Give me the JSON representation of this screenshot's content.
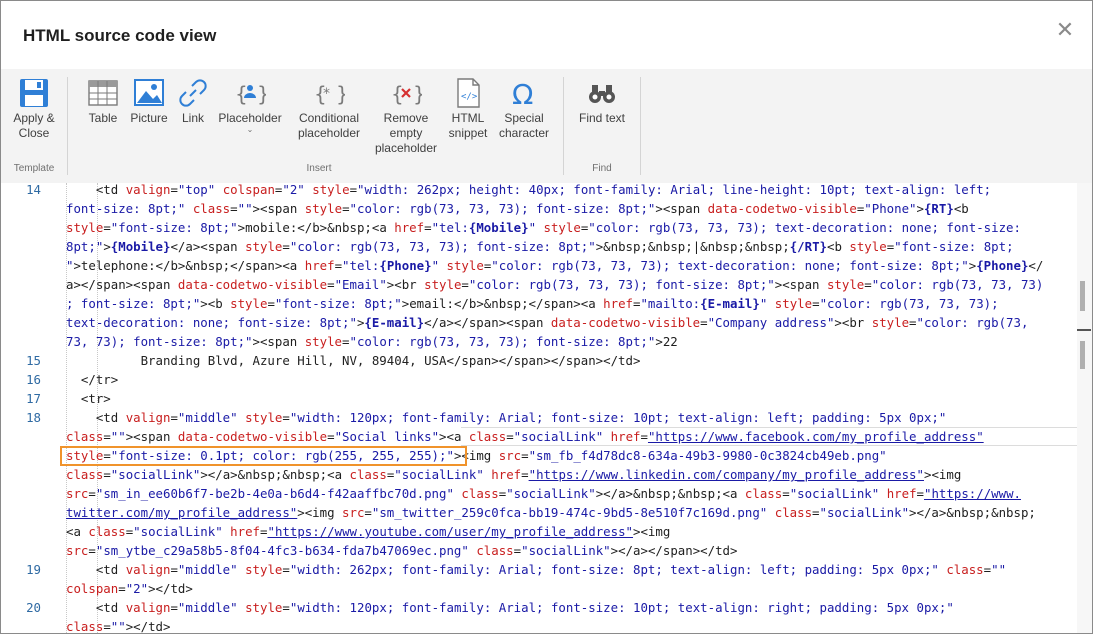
{
  "dialog": {
    "title": "HTML source code view",
    "close_glyph": "✕"
  },
  "ribbon": {
    "groups": [
      {
        "label": "Template"
      },
      {
        "label": "Insert"
      },
      {
        "label": "Find"
      }
    ],
    "buttons": {
      "apply_close": [
        "Apply &",
        "Close"
      ],
      "table": "Table",
      "picture": "Picture",
      "link": "Link",
      "placeholder": "Placeholder",
      "conditional": [
        "Conditional",
        "placeholder"
      ],
      "remove_empty": [
        "Remove",
        "empty",
        "placeholder"
      ],
      "html_snippet": [
        "HTML",
        "snippet"
      ],
      "special_char": [
        "Special",
        "character"
      ],
      "find_text": "Find text"
    },
    "accent": "#2f7fd6"
  },
  "code": {
    "line_numbers": [
      "14",
      "15",
      "16",
      "17",
      "18",
      "19",
      "20"
    ],
    "lines": [
      {
        "n": "14",
        "segs": [
          [
            "t",
            "    "
          ],
          [
            "g",
            "<td "
          ],
          [
            "a",
            "valign"
          ],
          [
            "g",
            "="
          ],
          [
            "v",
            "\"top\""
          ],
          [
            "g",
            " "
          ],
          [
            "a",
            "colspan"
          ],
          [
            "g",
            "="
          ],
          [
            "v",
            "\"2\""
          ],
          [
            "g",
            " "
          ],
          [
            "a",
            "style"
          ],
          [
            "g",
            "="
          ],
          [
            "v",
            "\"width: 262px; height: 40px; font-family: Arial; line-height: 10pt; text-align: left;"
          ]
        ]
      },
      {
        "n": "",
        "segs": [
          [
            "v",
            "font-size: 8pt;\""
          ],
          [
            "g",
            " "
          ],
          [
            "a",
            "class"
          ],
          [
            "g",
            "="
          ],
          [
            "v",
            "\"\""
          ],
          [
            "g",
            "><span "
          ],
          [
            "a",
            "style"
          ],
          [
            "g",
            "="
          ],
          [
            "v",
            "\"color: rgb(73, 73, 73); font-size: 8pt;\""
          ],
          [
            "g",
            "><span "
          ],
          [
            "a",
            "data-codetwo-visible"
          ],
          [
            "g",
            "="
          ],
          [
            "v",
            "\"Phone\""
          ],
          [
            "g",
            ">"
          ],
          [
            "b",
            "{RT}"
          ],
          [
            "g",
            "<b"
          ]
        ]
      },
      {
        "n": "",
        "segs": [
          [
            "a",
            "style"
          ],
          [
            "g",
            "="
          ],
          [
            "v",
            "\"font-size: 8pt;\""
          ],
          [
            "g",
            ">mobile:</b>&nbsp;<a "
          ],
          [
            "a",
            "href"
          ],
          [
            "g",
            "="
          ],
          [
            "v",
            "\"tel:"
          ],
          [
            "b",
            "{Mobile}"
          ],
          [
            "v",
            "\""
          ],
          [
            "g",
            " "
          ],
          [
            "a",
            "style"
          ],
          [
            "g",
            "="
          ],
          [
            "v",
            "\"color: rgb(73, 73, 73); text-decoration: none; font-size:"
          ]
        ]
      },
      {
        "n": "",
        "segs": [
          [
            "v",
            "8pt;\""
          ],
          [
            "g",
            ">"
          ],
          [
            "b",
            "{Mobile}"
          ],
          [
            "g",
            "</a><span "
          ],
          [
            "a",
            "style"
          ],
          [
            "g",
            "="
          ],
          [
            "v",
            "\"color: rgb(73, 73, 73); font-size: 8pt;\""
          ],
          [
            "g",
            ">&nbsp;&nbsp;|&nbsp;&nbsp;"
          ],
          [
            "b",
            "{/RT}"
          ],
          [
            "g",
            "<b "
          ],
          [
            "a",
            "style"
          ],
          [
            "g",
            "="
          ],
          [
            "v",
            "\"font-size: 8pt;"
          ]
        ]
      },
      {
        "n": "",
        "segs": [
          [
            "v",
            "\""
          ],
          [
            "g",
            ">telephone:</b>&nbsp;</span><a "
          ],
          [
            "a",
            "href"
          ],
          [
            "g",
            "="
          ],
          [
            "v",
            "\"tel:"
          ],
          [
            "b",
            "{Phone}"
          ],
          [
            "v",
            "\""
          ],
          [
            "g",
            " "
          ],
          [
            "a",
            "style"
          ],
          [
            "g",
            "="
          ],
          [
            "v",
            "\"color: rgb(73, 73, 73); text-decoration: none; font-size: 8pt;\""
          ],
          [
            "g",
            ">"
          ],
          [
            "b",
            "{Phone}"
          ],
          [
            "g",
            "</"
          ]
        ]
      },
      {
        "n": "",
        "segs": [
          [
            "g",
            "a></span><span "
          ],
          [
            "a",
            "data-codetwo-visible"
          ],
          [
            "g",
            "="
          ],
          [
            "v",
            "\"Email\""
          ],
          [
            "g",
            "><br "
          ],
          [
            "a",
            "style"
          ],
          [
            "g",
            "="
          ],
          [
            "v",
            "\"color: rgb(73, 73, 73); font-size: 8pt;\""
          ],
          [
            "g",
            "><span "
          ],
          [
            "a",
            "style"
          ],
          [
            "g",
            "="
          ],
          [
            "v",
            "\"color: rgb(73, 73, 73)"
          ]
        ]
      },
      {
        "n": "",
        "segs": [
          [
            "v",
            "; font-size: 8pt;\""
          ],
          [
            "g",
            "><b "
          ],
          [
            "a",
            "style"
          ],
          [
            "g",
            "="
          ],
          [
            "v",
            "\"font-size: 8pt;\""
          ],
          [
            "g",
            ">email:</b>&nbsp;</span><a "
          ],
          [
            "a",
            "href"
          ],
          [
            "g",
            "="
          ],
          [
            "v",
            "\"mailto:"
          ],
          [
            "b",
            "{E-mail}"
          ],
          [
            "v",
            "\""
          ],
          [
            "g",
            " "
          ],
          [
            "a",
            "style"
          ],
          [
            "g",
            "="
          ],
          [
            "v",
            "\"color: rgb(73, 73, 73);"
          ]
        ]
      },
      {
        "n": "",
        "segs": [
          [
            "v",
            "text-decoration: none; font-size: 8pt;\""
          ],
          [
            "g",
            ">"
          ],
          [
            "b",
            "{E-mail}"
          ],
          [
            "g",
            "</a></span><span "
          ],
          [
            "a",
            "data-codetwo-visible"
          ],
          [
            "g",
            "="
          ],
          [
            "v",
            "\"Company address\""
          ],
          [
            "g",
            "><br "
          ],
          [
            "a",
            "style"
          ],
          [
            "g",
            "="
          ],
          [
            "v",
            "\"color: rgb(73,"
          ]
        ]
      },
      {
        "n": "",
        "segs": [
          [
            "v",
            "73, 73); font-size: 8pt;\""
          ],
          [
            "g",
            "><span "
          ],
          [
            "a",
            "style"
          ],
          [
            "g",
            "="
          ],
          [
            "v",
            "\"color: rgb(73, 73, 73); font-size: 8pt;\""
          ],
          [
            "g",
            ">22"
          ]
        ]
      },
      {
        "n": "15",
        "segs": [
          [
            "t",
            "          Branding Blvd, Azure Hill, NV, 89404, USA"
          ],
          [
            "g",
            "</span></span></span></td>"
          ]
        ]
      },
      {
        "n": "16",
        "segs": [
          [
            "t",
            "  "
          ],
          [
            "g",
            "</tr>"
          ]
        ]
      },
      {
        "n": "17",
        "segs": [
          [
            "t",
            "  "
          ],
          [
            "g",
            "<tr>"
          ]
        ]
      },
      {
        "n": "18",
        "segs": [
          [
            "t",
            "    "
          ],
          [
            "g",
            "<td "
          ],
          [
            "a",
            "valign"
          ],
          [
            "g",
            "="
          ],
          [
            "v",
            "\"middle\""
          ],
          [
            "g",
            " "
          ],
          [
            "a",
            "style"
          ],
          [
            "g",
            "="
          ],
          [
            "v",
            "\"width: 120px; font-family: Arial; font-size: 10pt; text-align: left; padding: 5px 0px;\""
          ]
        ]
      },
      {
        "n": "",
        "segs": [
          [
            "a",
            "class"
          ],
          [
            "g",
            "="
          ],
          [
            "v",
            "\"\""
          ],
          [
            "g",
            "><span "
          ],
          [
            "a",
            "data-codetwo-visible"
          ],
          [
            "g",
            "="
          ],
          [
            "v",
            "\"Social links\""
          ],
          [
            "g",
            "><a "
          ],
          [
            "a",
            "class"
          ],
          [
            "g",
            "="
          ],
          [
            "v",
            "\"socialLink\""
          ],
          [
            "g",
            " "
          ],
          [
            "a",
            "href"
          ],
          [
            "g",
            "="
          ],
          [
            "u",
            "\"https://www.facebook.com/my_profile_address\""
          ]
        ]
      },
      {
        "n": "",
        "segs": [
          [
            "a",
            "style"
          ],
          [
            "g",
            "="
          ],
          [
            "v",
            "\"font-size: 0.1pt; color: rgb(255, 255, 255);\""
          ],
          [
            "g",
            "><img "
          ],
          [
            "a",
            "src"
          ],
          [
            "g",
            "="
          ],
          [
            "v",
            "\"sm_fb_f4d78dc8-634a-49b3-9980-0c3824cb49eb.png\""
          ]
        ]
      },
      {
        "n": "",
        "segs": [
          [
            "a",
            "class"
          ],
          [
            "g",
            "="
          ],
          [
            "v",
            "\"socialLink\""
          ],
          [
            "g",
            "></a>&nbsp;&nbsp;<a "
          ],
          [
            "a",
            "class"
          ],
          [
            "g",
            "="
          ],
          [
            "v",
            "\"socialLink\""
          ],
          [
            "g",
            " "
          ],
          [
            "a",
            "href"
          ],
          [
            "g",
            "="
          ],
          [
            "u",
            "\"https://www.linkedin.com/company/my_profile_address\""
          ],
          [
            "g",
            "><img"
          ]
        ]
      },
      {
        "n": "",
        "segs": [
          [
            "a",
            "src"
          ],
          [
            "g",
            "="
          ],
          [
            "v",
            "\"sm_in_ee60b6f7-be2b-4e0a-b6d4-f42aaffbc70d.png\""
          ],
          [
            "g",
            " "
          ],
          [
            "a",
            "class"
          ],
          [
            "g",
            "="
          ],
          [
            "v",
            "\"socialLink\""
          ],
          [
            "g",
            "></a>&nbsp;&nbsp;<a "
          ],
          [
            "a",
            "class"
          ],
          [
            "g",
            "="
          ],
          [
            "v",
            "\"socialLink\""
          ],
          [
            "g",
            " "
          ],
          [
            "a",
            "href"
          ],
          [
            "g",
            "="
          ],
          [
            "u",
            "\"https://www."
          ]
        ]
      },
      {
        "n": "",
        "segs": [
          [
            "u",
            "twitter.com/my_profile_address\""
          ],
          [
            "g",
            "><img "
          ],
          [
            "a",
            "src"
          ],
          [
            "g",
            "="
          ],
          [
            "v",
            "\"sm_twitter_259c0fca-bb19-474c-9bd5-8e510f7c169d.png\""
          ],
          [
            "g",
            " "
          ],
          [
            "a",
            "class"
          ],
          [
            "g",
            "="
          ],
          [
            "v",
            "\"socialLink\""
          ],
          [
            "g",
            "></a>&nbsp;&nbsp;"
          ]
        ]
      },
      {
        "n": "",
        "segs": [
          [
            "g",
            "<a "
          ],
          [
            "a",
            "class"
          ],
          [
            "g",
            "="
          ],
          [
            "v",
            "\"socialLink\""
          ],
          [
            "g",
            " "
          ],
          [
            "a",
            "href"
          ],
          [
            "g",
            "="
          ],
          [
            "u",
            "\"https://www.youtube.com/user/my_profile_address\""
          ],
          [
            "g",
            "><img"
          ]
        ]
      },
      {
        "n": "",
        "segs": [
          [
            "a",
            "src"
          ],
          [
            "g",
            "="
          ],
          [
            "v",
            "\"sm_ytbe_c29a58b5-8f04-4fc3-b634-fda7b47069ec.png\""
          ],
          [
            "g",
            " "
          ],
          [
            "a",
            "class"
          ],
          [
            "g",
            "="
          ],
          [
            "v",
            "\"socialLink\""
          ],
          [
            "g",
            "></a></span></td>"
          ]
        ]
      },
      {
        "n": "19",
        "segs": [
          [
            "t",
            "    "
          ],
          [
            "g",
            "<td "
          ],
          [
            "a",
            "valign"
          ],
          [
            "g",
            "="
          ],
          [
            "v",
            "\"middle\""
          ],
          [
            "g",
            " "
          ],
          [
            "a",
            "style"
          ],
          [
            "g",
            "="
          ],
          [
            "v",
            "\"width: 262px; font-family: Arial; font-size: 8pt; text-align: left; padding: 5px 0px;\""
          ],
          [
            "g",
            " "
          ],
          [
            "a",
            "class"
          ],
          [
            "g",
            "="
          ],
          [
            "v",
            "\"\""
          ]
        ]
      },
      {
        "n": "",
        "segs": [
          [
            "a",
            "colspan"
          ],
          [
            "g",
            "="
          ],
          [
            "v",
            "\"2\""
          ],
          [
            "g",
            "></td>"
          ]
        ]
      },
      {
        "n": "20",
        "segs": [
          [
            "t",
            "    "
          ],
          [
            "g",
            "<td "
          ],
          [
            "a",
            "valign"
          ],
          [
            "g",
            "="
          ],
          [
            "v",
            "\"middle\""
          ],
          [
            "g",
            " "
          ],
          [
            "a",
            "style"
          ],
          [
            "g",
            "="
          ],
          [
            "v",
            "\"width: 120px; font-family: Arial; font-size: 10pt; text-align: right; padding: 5px 0px;\""
          ]
        ]
      },
      {
        "n": "",
        "segs": [
          [
            "a",
            "class"
          ],
          [
            "g",
            "="
          ],
          [
            "v",
            "\"\""
          ],
          [
            "g",
            "></td>"
          ]
        ]
      }
    ]
  }
}
